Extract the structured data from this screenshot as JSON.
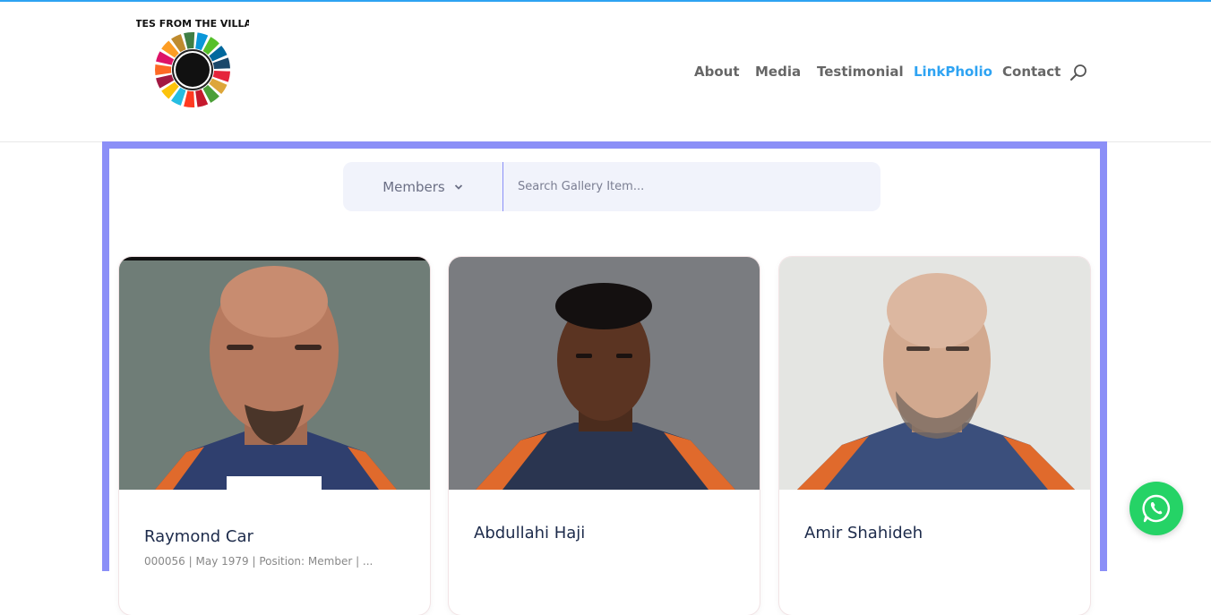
{
  "brand": {
    "logo_text": "NOTES FROM THE VILLAGE",
    "accent_color": "#2ea3f2"
  },
  "nav": {
    "items": [
      {
        "label": "About",
        "active": false
      },
      {
        "label": "Media",
        "active": false
      },
      {
        "label": "Testimonial",
        "active": false
      },
      {
        "label": "LinkPholio",
        "active": true
      },
      {
        "label": "Contact",
        "active": false
      }
    ],
    "search_icon": "search-icon"
  },
  "gallery": {
    "frame_color": "#8b8ff7",
    "filter": {
      "category_label": "Members",
      "category_icon": "chevron-down-icon"
    },
    "search": {
      "placeholder": "Search Gallery Item..."
    },
    "cards": [
      {
        "name": "Raymond Car",
        "subtitle": "000056 | May 1979 | Position: Member | ..."
      },
      {
        "name": "Abdullahi Haji"
      },
      {
        "name": "Amir Shahideh"
      }
    ]
  },
  "chat_widget": {
    "icon": "whatsapp-icon",
    "color": "#25d366"
  }
}
